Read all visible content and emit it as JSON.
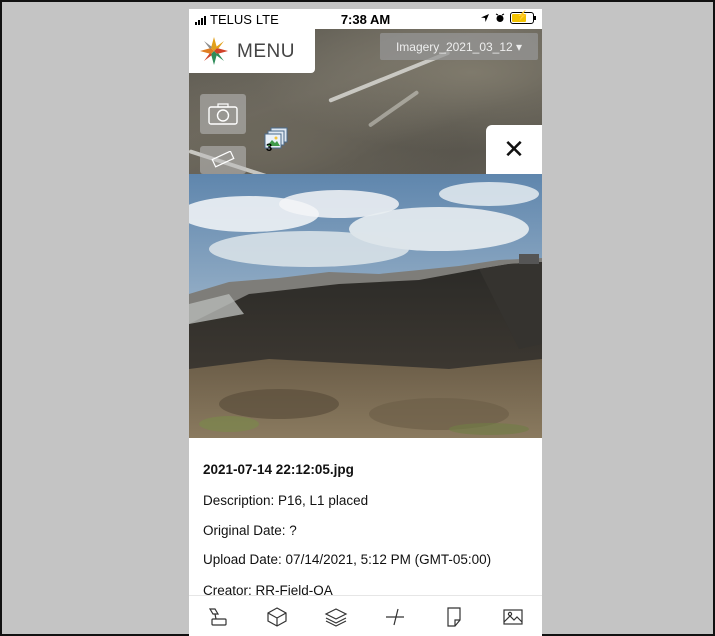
{
  "status_bar": {
    "carrier": "TELUS",
    "network": "LTE",
    "time": "7:38 AM"
  },
  "map": {
    "menu_label": "MENU",
    "imagery_selector": "Imagery_2021_03_12 ▾",
    "photo_count": "3",
    "close_glyph": "✕"
  },
  "photo_details": {
    "filename": "2021-07-14 22:12:05.jpg",
    "description": "Description: P16, L1 placed",
    "original_date": "Original Date: ?",
    "upload_date": "Upload Date: 07/14/2021, 5:12 PM (GMT-05:00)",
    "creator": "Creator: RR-Field-QA"
  },
  "toolbar": {
    "icons": [
      "draw-icon",
      "cube-icon",
      "layers-icon",
      "measure-icon",
      "note-icon",
      "image-icon"
    ]
  }
}
